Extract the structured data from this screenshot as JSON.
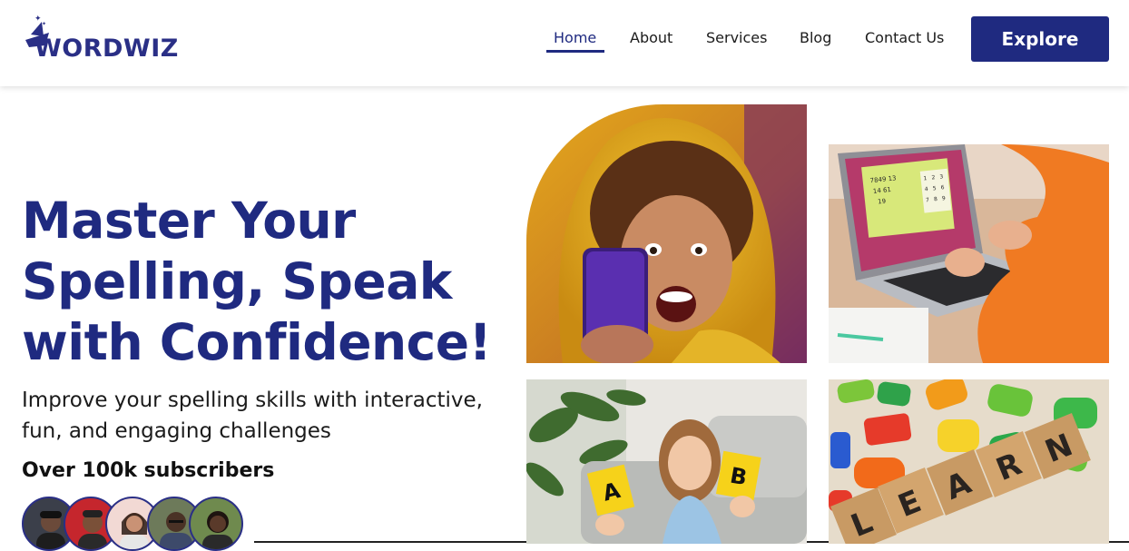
{
  "brand": {
    "logo_text": "WORDWIZ",
    "logo_icon": "wizard-hat-icon",
    "accent_color": "#1f2a80"
  },
  "nav": {
    "items": [
      {
        "label": "Home",
        "active": true
      },
      {
        "label": "About",
        "active": false
      },
      {
        "label": "Services",
        "active": false
      },
      {
        "label": "Blog",
        "active": false
      },
      {
        "label": "Contact Us",
        "active": false
      }
    ],
    "cta_label": "Explore"
  },
  "hero": {
    "title_lines": [
      "Master Your",
      "Spelling, Speak",
      "with Confidence!"
    ],
    "subtitle_lines": [
      "Improve your spelling skills with interactive,",
      "fun, and engaging challenges"
    ],
    "subscribers_text": "Over 100k subscribers",
    "avatar_count": 5
  },
  "gallery": {
    "images": [
      {
        "name": "excited-child-with-phone-image"
      },
      {
        "name": "child-using-laptop-image"
      },
      {
        "name": "girl-holding-letter-cards-image"
      },
      {
        "name": "learn-wooden-blocks-image"
      }
    ],
    "card_a_letter": "A",
    "card_b_letter": "B",
    "blocks_word": [
      "L",
      "E",
      "A",
      "R",
      "N"
    ],
    "laptop_screen_numbers": [
      "7849 13",
      "14 61",
      "19"
    ],
    "laptop_keypad": [
      "1",
      "2",
      "3",
      "4",
      "5",
      "6",
      "7",
      "8",
      "9"
    ]
  }
}
